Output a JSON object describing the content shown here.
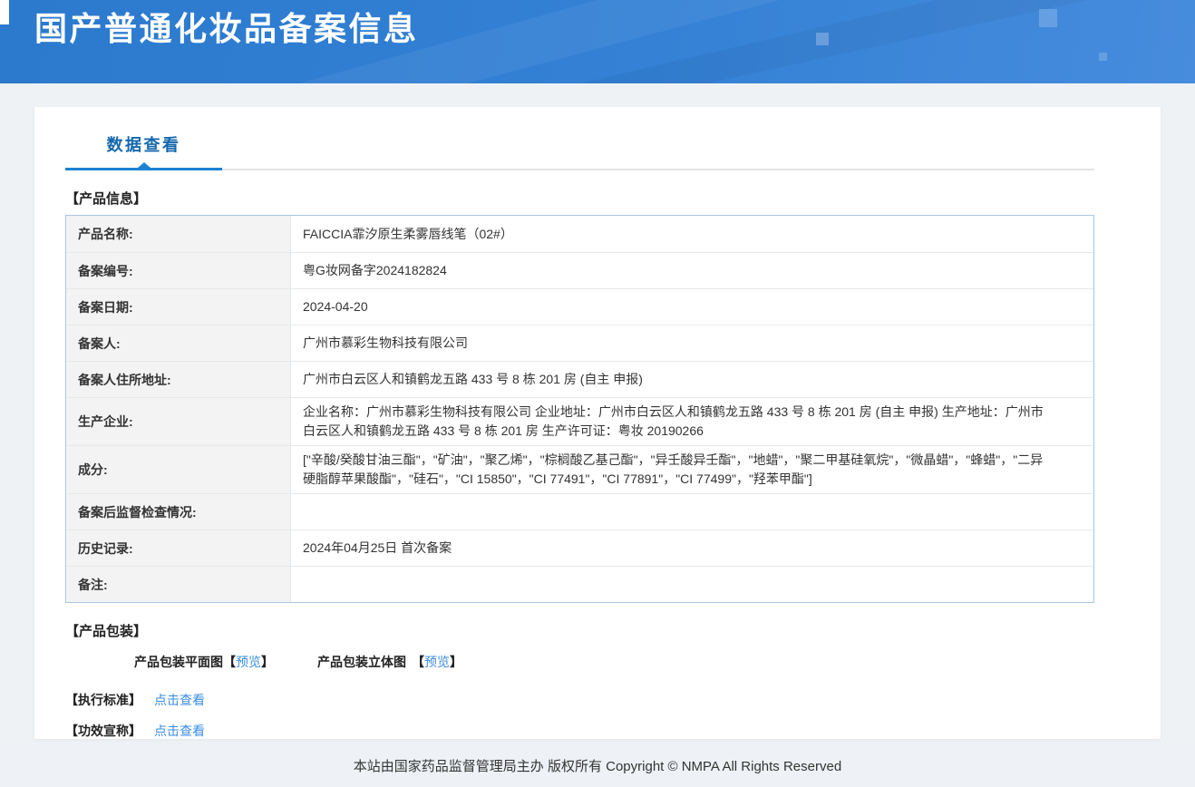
{
  "banner": {
    "title": "国产普通化妆品备案信息"
  },
  "tabs": {
    "data_view": "数据查看"
  },
  "product_info": {
    "section_title": "【产品信息】",
    "rows": [
      {
        "label": "产品名称:",
        "value": "FAICCIA霏汐原生柔雾唇线笔（02#）"
      },
      {
        "label": "备案编号:",
        "value": "粤G妆网备字2024182824"
      },
      {
        "label": "备案日期:",
        "value": "2024-04-20"
      },
      {
        "label": "备案人:",
        "value": "广州市慕彩生物科技有限公司"
      },
      {
        "label": "备案人住所地址:",
        "value": "广州市白云区人和镇鹤龙五路 433 号 8 栋 201 房 (自主 申报)"
      },
      {
        "label": "生产企业:",
        "value": "企业名称：广州市慕彩生物科技有限公司 企业地址：广州市白云区人和镇鹤龙五路 433 号 8 栋 201 房 (自主 申报)  生产地址：广州市白云区人和镇鹤龙五路 433 号 8 栋 201 房 生产许可证：粤妆 20190266"
      },
      {
        "label": "成分:",
        "value": "[\"辛酸/癸酸甘油三酯\"，\"矿油\"，\"聚乙烯\"，\"棕榈酸乙基己酯\"，\"异壬酸异壬酯\"，\"地蜡\"，\"聚二甲基硅氧烷\"，\"微晶蜡\"，\"蜂蜡\"，\"二异硬脂醇苹果酸酯\"，\"硅石\"，\"CI 15850\"，\"CI 77491\"，\"CI 77891\"，\"CI 77499\"，\"羟苯甲酯\"]"
      },
      {
        "label": "备案后监督检查情况:",
        "value": ""
      },
      {
        "label": "历史记录:",
        "value": "2024年04月25日 首次备案"
      },
      {
        "label": "备注:",
        "value": ""
      }
    ]
  },
  "packaging": {
    "section_title": "【产品包装】",
    "items": [
      {
        "name": "产品包装平面图",
        "bracket_open": "【",
        "link": "预览",
        "bracket_close": "】"
      },
      {
        "name": "产品包装立体图",
        "bracket_open": "【",
        "link": "预览",
        "bracket_close": "】"
      }
    ]
  },
  "exec_standard": {
    "title": "【执行标准】",
    "link": "点击查看"
  },
  "efficacy_claim": {
    "title": "【功效宣称】",
    "link": "点击查看"
  },
  "footer": {
    "copyright": "本站由国家药品监督管理局主办 版权所有 Copyright © NMPA All Rights Reserved"
  },
  "colors": {
    "banner_gradient_start": "#2b7ace",
    "banner_gradient_end": "#478cdd",
    "tab_text_blue": "#1467ae",
    "tab_indicator_blue": "#1e82d2",
    "link_blue": "#3a8de2",
    "table_border_blue": "#a9c6e4",
    "label_column_bg": "#f3f3f3",
    "page_bg": "#eef2f5"
  }
}
